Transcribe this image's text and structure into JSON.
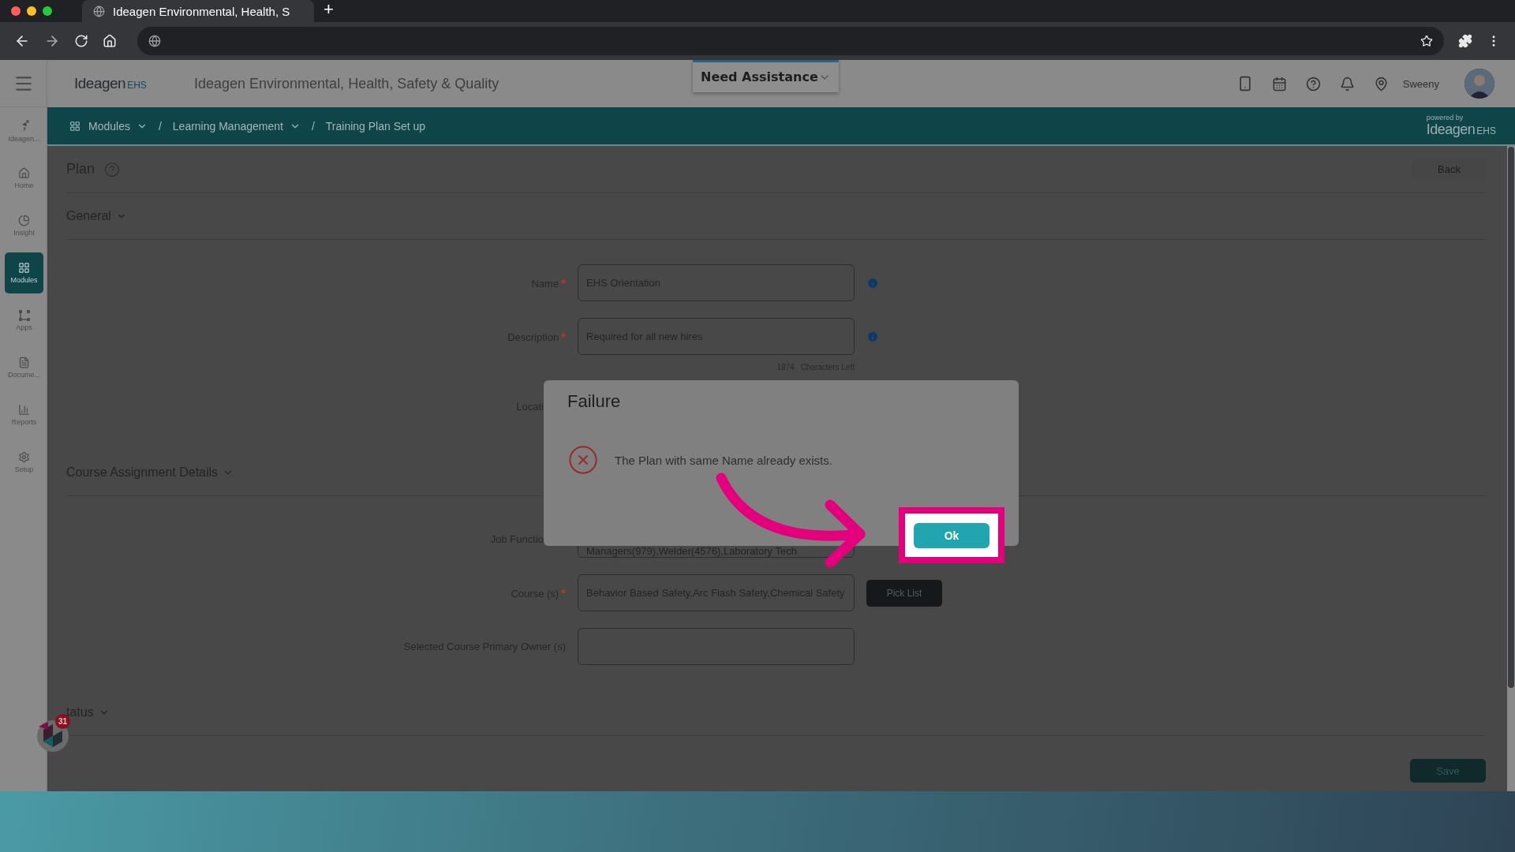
{
  "browser": {
    "tab_title": "Ideagen Environmental, Health, S",
    "new_tab": "+"
  },
  "header": {
    "logo": {
      "name": "Ideagen",
      "suffix": "EHS"
    },
    "title": "Ideagen Environmental, Health, Safety & Quality",
    "assistance": "Need Assistance",
    "user": "Sweeny"
  },
  "breadcrumb": {
    "separator": "/",
    "items": [
      {
        "label": "Modules",
        "dropdown": true
      },
      {
        "label": "Learning Management",
        "dropdown": true
      },
      {
        "label": "Training Plan Set up",
        "dropdown": false
      }
    ],
    "powered_by": "powered by",
    "powered_logo": {
      "name": "Ideagen",
      "suffix": "EHS"
    }
  },
  "sidebar": [
    {
      "label": "Ideagen...",
      "selected": false
    },
    {
      "label": "Home",
      "selected": false
    },
    {
      "label": "Insight",
      "selected": false
    },
    {
      "label": "Modules",
      "selected": true
    },
    {
      "label": "Apps",
      "selected": false
    },
    {
      "label": "Docume...",
      "selected": false
    },
    {
      "label": "Reports",
      "selected": false
    },
    {
      "label": "Setup",
      "selected": false
    }
  ],
  "page": {
    "title": "Plan",
    "back": "Back",
    "save": "Save"
  },
  "sections": [
    {
      "title": "General",
      "rows": [
        {
          "kind": "field",
          "label": "Name",
          "required_mark": "*",
          "value": "EHS Orientation",
          "info": true
        },
        {
          "kind": "field",
          "label": "Description",
          "required_mark": "*",
          "value": "Required for all new hires",
          "info": true,
          "counter": {
            "count": "1974",
            "text": "Characters Left"
          }
        },
        {
          "kind": "covered",
          "label": "Locati"
        }
      ]
    },
    {
      "title": "Course Assignment Details",
      "rows": [
        {
          "kind": "field",
          "label": "Job Functio",
          "covered": true,
          "value": "Managers(979),Welder(4576),Laboratory Tech",
          "info": false
        },
        {
          "kind": "field",
          "label": "Course (s)",
          "required_mark": "*",
          "value": "Behavior Based Safety,Arc Flash Safety,Chemical Safety",
          "info": false,
          "button": "Pick List"
        },
        {
          "kind": "field",
          "label": "Selected Course Primary Owner (s)",
          "info": false
        }
      ]
    },
    {
      "title": "tatus"
    }
  ],
  "widget": {
    "badge": "31"
  },
  "dialog": {
    "title": "Failure",
    "message": "The Plan with same Name already exists.",
    "ok": "Ok"
  }
}
